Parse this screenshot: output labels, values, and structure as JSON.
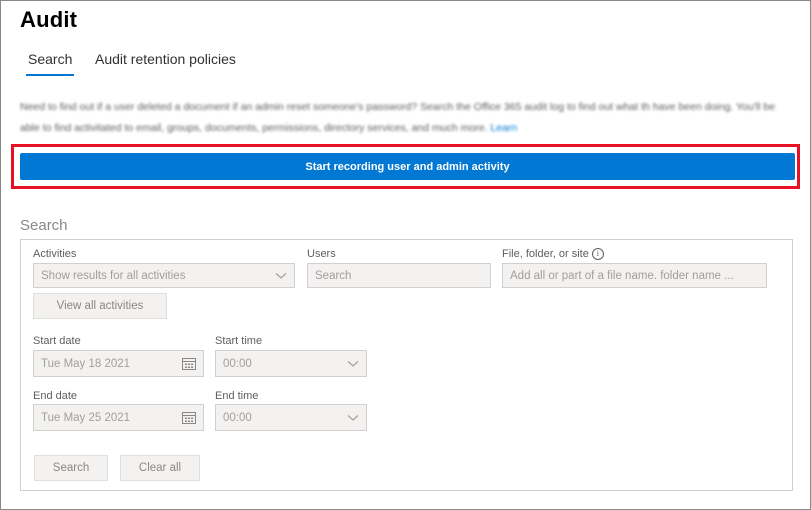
{
  "page": {
    "title": "Audit"
  },
  "tabs": [
    {
      "label": "Search",
      "active": true
    },
    {
      "label": "Audit retention policies",
      "active": false
    }
  ],
  "intro": {
    "text": "Need to find out if a user deleted a document if an admin reset someone's password? Search the Office 365 audit log to find out what th have been doing. You'll be able to find activitated to email, groups, documents, permissions, directory services, and much more.",
    "link": "Learn"
  },
  "cta": {
    "label": "Start recording user and admin activity"
  },
  "search": {
    "heading": "Search",
    "activities": {
      "label": "Activities",
      "value": "Show results for all activities"
    },
    "users": {
      "label": "Users",
      "placeholder": "Search"
    },
    "file": {
      "label": "File, folder, or site",
      "info_icon": "i",
      "placeholder": "Add all or part of a file name. folder name ..."
    },
    "view_all_label": "View all activities",
    "start_date": {
      "label": "Start date",
      "value": "Tue May 18 2021"
    },
    "start_time": {
      "label": "Start time",
      "value": "00:00"
    },
    "end_date": {
      "label": "End date",
      "value": "Tue May 25 2021"
    },
    "end_time": {
      "label": "End time",
      "value": "00:00"
    },
    "search_button": "Search",
    "clear_button": "Clear all"
  },
  "colors": {
    "accent": "#0078d4",
    "highlight": "#e81123"
  }
}
